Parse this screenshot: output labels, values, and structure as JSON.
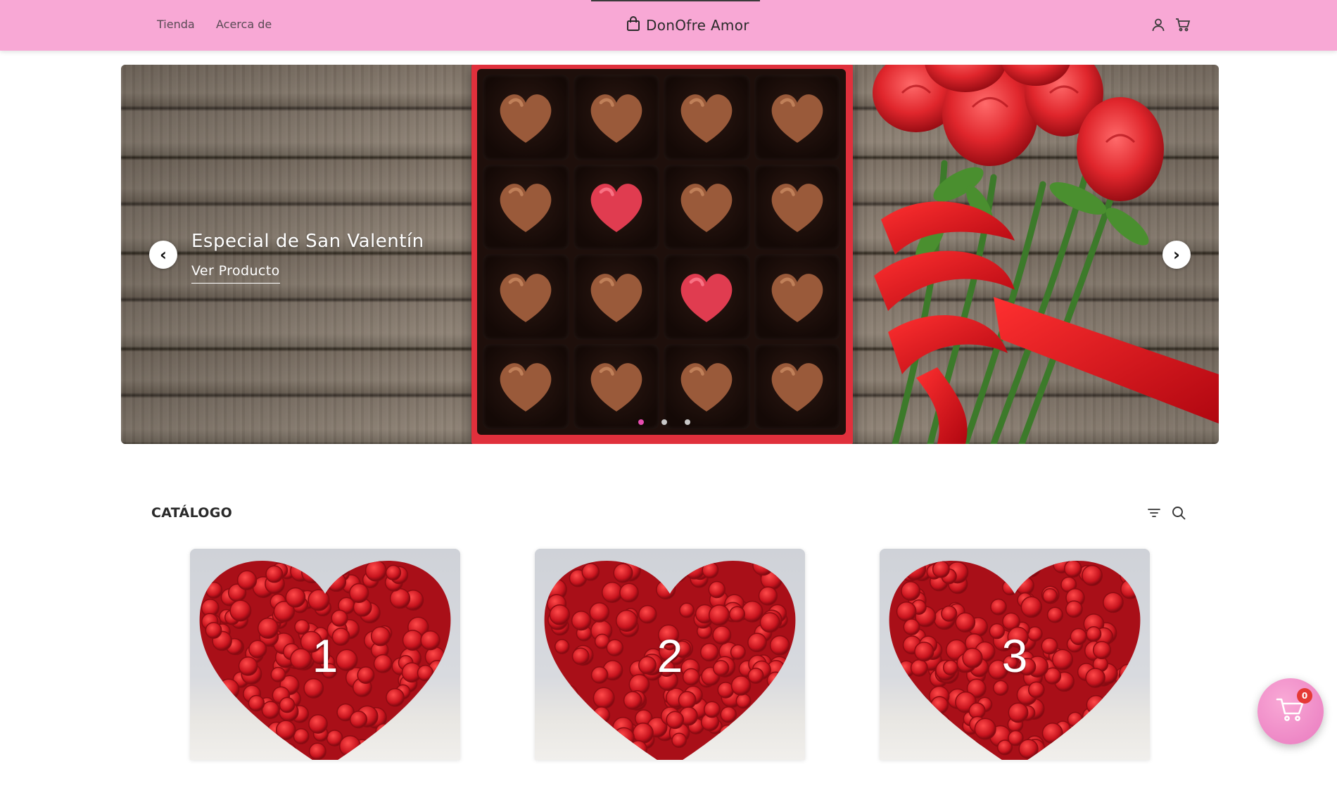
{
  "header": {
    "nav": [
      "Tienda",
      "Acerca de"
    ],
    "brand_name": "DonOfre Amor",
    "icons": [
      "shopping-bag-icon",
      "user-icon",
      "cart-icon"
    ],
    "background_color": "#f8a8d5"
  },
  "hero": {
    "title": "Especial de San Valentín",
    "link_label": "Ver Producto",
    "prev_label": "‹",
    "next_label": "›",
    "slide_count": 3,
    "active_slide": 1,
    "active_dot_color": "#e84db1"
  },
  "catalog": {
    "title": "CATÁLOGO",
    "icons": [
      "filter-icon",
      "search-icon"
    ],
    "products": [
      {
        "label": "1"
      },
      {
        "label": "2"
      },
      {
        "label": "3"
      }
    ]
  },
  "floating_cart": {
    "count": "0",
    "icon": "cart-icon",
    "badge_color": "#e53935"
  }
}
